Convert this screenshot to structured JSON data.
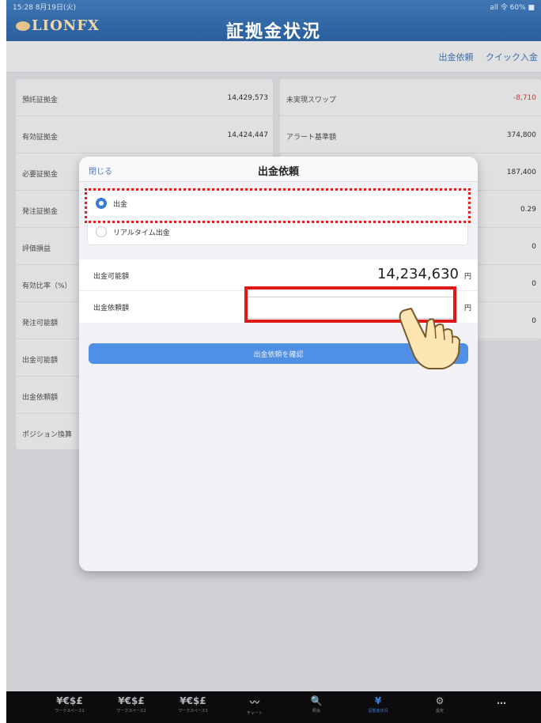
{
  "status": {
    "time": "15:28 8月19日(火)",
    "right": "all 令 60% ■"
  },
  "header": {
    "logo": "LIONFX",
    "title": "証拠金状況"
  },
  "subbar": {
    "links": [
      "出金依頼",
      "クイック入金"
    ]
  },
  "left_panel": [
    {
      "label": "預託証拠金",
      "value": "14,429,573"
    },
    {
      "label": "有効証拠金",
      "value": "14,424,447"
    },
    {
      "label": "必要証拠金",
      "value": ""
    },
    {
      "label": "発注証拠金",
      "value": ""
    },
    {
      "label": "評価損益",
      "value": ""
    },
    {
      "label": "有効比率（%）",
      "value": ""
    },
    {
      "label": "発注可能額",
      "value": ""
    },
    {
      "label": "出金可能額",
      "value": ""
    },
    {
      "label": "出金依頼額",
      "value": ""
    },
    {
      "label": "ポジション換算",
      "value": ""
    }
  ],
  "right_panel": [
    {
      "label": "未実現スワップ",
      "value": "-8,710",
      "negative": true
    },
    {
      "label": "アラート基準額",
      "value": "374,800"
    },
    {
      "label": "",
      "value": "187,400"
    },
    {
      "label": "",
      "value": "0.29"
    },
    {
      "label": "",
      "value": "0"
    },
    {
      "label": "",
      "value": "0"
    },
    {
      "label": "",
      "value": "0"
    }
  ],
  "modal": {
    "close": "閉じる",
    "title": "出金依頼",
    "options": [
      {
        "label": "出金",
        "selected": true
      },
      {
        "label": "リアルタイム出金",
        "selected": false
      }
    ],
    "available_label": "出金可能額",
    "available_amount": "14,234,630",
    "unit": "円",
    "request_label": "出金依頼額",
    "request_value": "",
    "confirm_button": "出金依頼を確認"
  },
  "tabbar": [
    {
      "icon": "¥€$£",
      "label": "ワークスペース1",
      "active": false
    },
    {
      "icon": "¥€$£",
      "label": "ワークスペース2",
      "active": false
    },
    {
      "icon": "¥€$£",
      "label": "ワークスペース3",
      "active": false
    },
    {
      "icon": "chart",
      "label": "チャート",
      "active": false
    },
    {
      "icon": "search",
      "label": "照会",
      "active": false
    },
    {
      "icon": "¥",
      "label": "証拠金状況",
      "active": true
    },
    {
      "icon": "gear",
      "label": "設定",
      "active": false
    },
    {
      "icon": "…",
      "label": "",
      "active": false
    }
  ],
  "colors": {
    "accent": "#3a7ad8",
    "header": "#2f66a8",
    "highlight": "#e01818",
    "negative": "#e0413c"
  }
}
